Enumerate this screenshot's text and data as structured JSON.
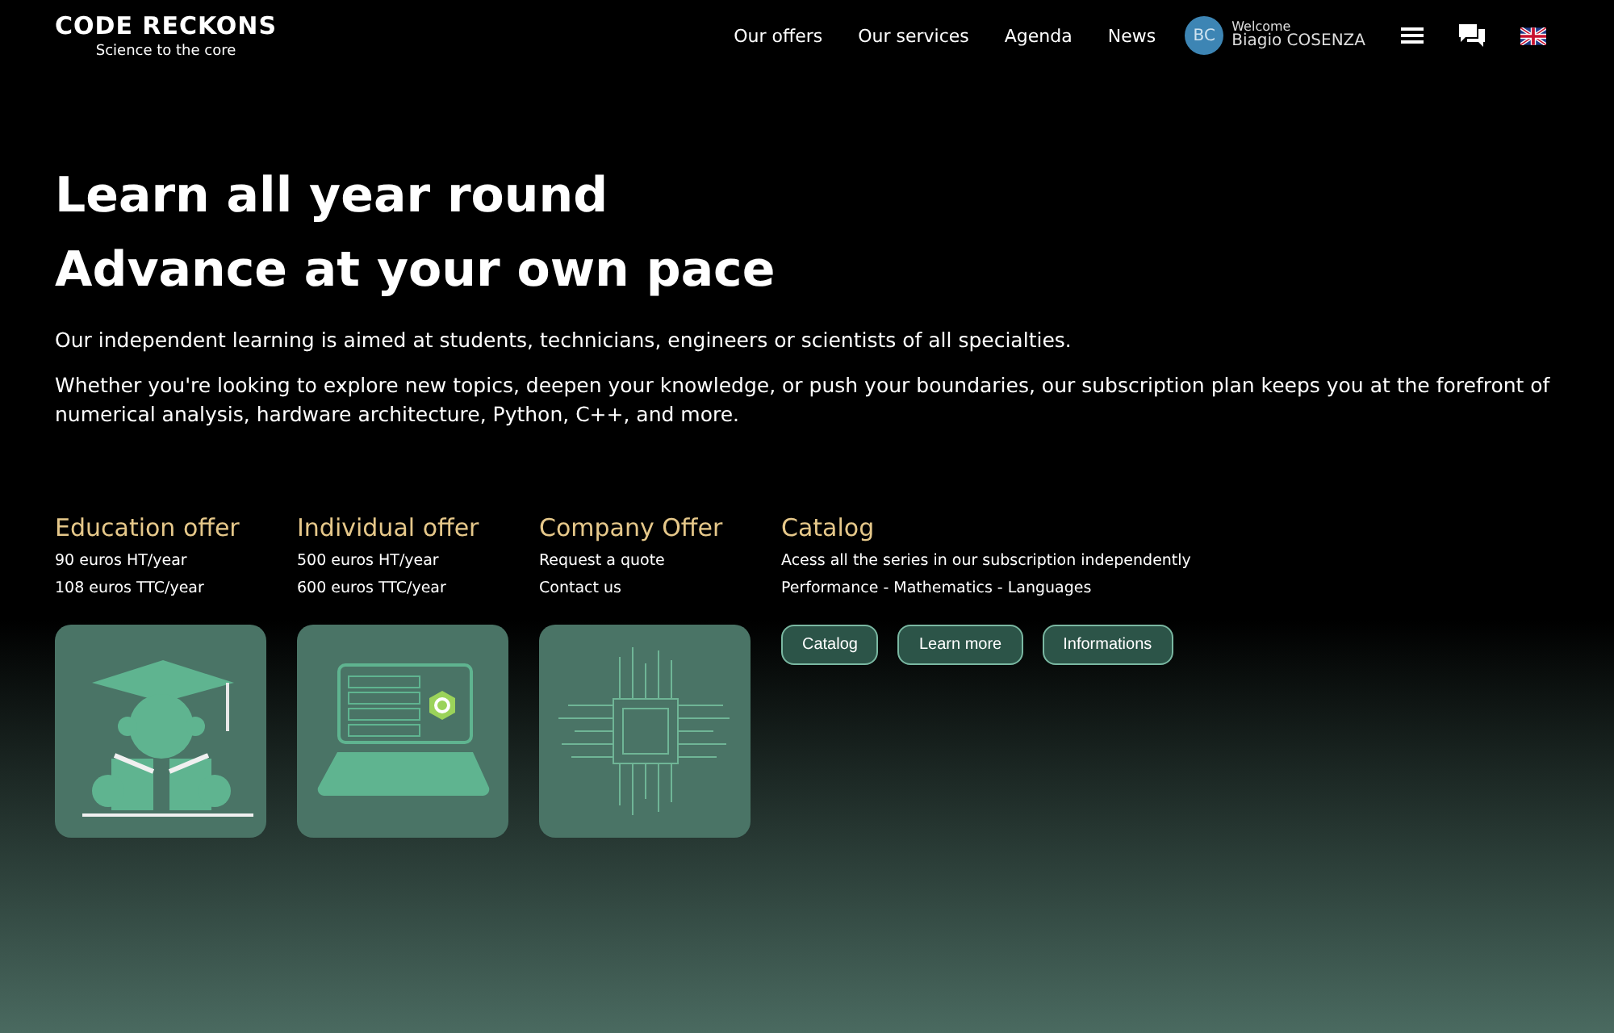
{
  "header": {
    "logo": "CODE RECKONS",
    "tagline": "Science to the core",
    "nav": [
      "Our offers",
      "Our services",
      "Agenda",
      "News"
    ],
    "user": {
      "initials": "BC",
      "greeting": "Welcome",
      "name": "Biagio COSENZA"
    }
  },
  "hero": {
    "titles": [
      "Learn all year round",
      "Advance at your own pace"
    ],
    "paragraphs": [
      "Our independent learning is aimed at students, technicians, engineers or scientists of all specialties.",
      "Whether you're looking to explore new topics, deepen your knowledge, or push your boundaries, our subscription plan keeps you at the forefront of numerical analysis, hardware architecture, Python, C++, and more."
    ]
  },
  "offers": [
    {
      "title": "Education offer",
      "lines": [
        "90 euros HT/year",
        "108 euros TTC/year"
      ]
    },
    {
      "title": "Individual offer",
      "lines": [
        "500 euros HT/year",
        "600 euros TTC/year"
      ]
    },
    {
      "title": "Company Offer",
      "lines": [
        "Request a quote",
        "Contact us"
      ]
    }
  ],
  "catalog": {
    "title": "Catalog",
    "lines": [
      "Acess all the series in our subscription independently",
      "Performance - Mathematics - Languages"
    ],
    "buttons": [
      "Catalog",
      "Learn more",
      "Informations"
    ]
  }
}
